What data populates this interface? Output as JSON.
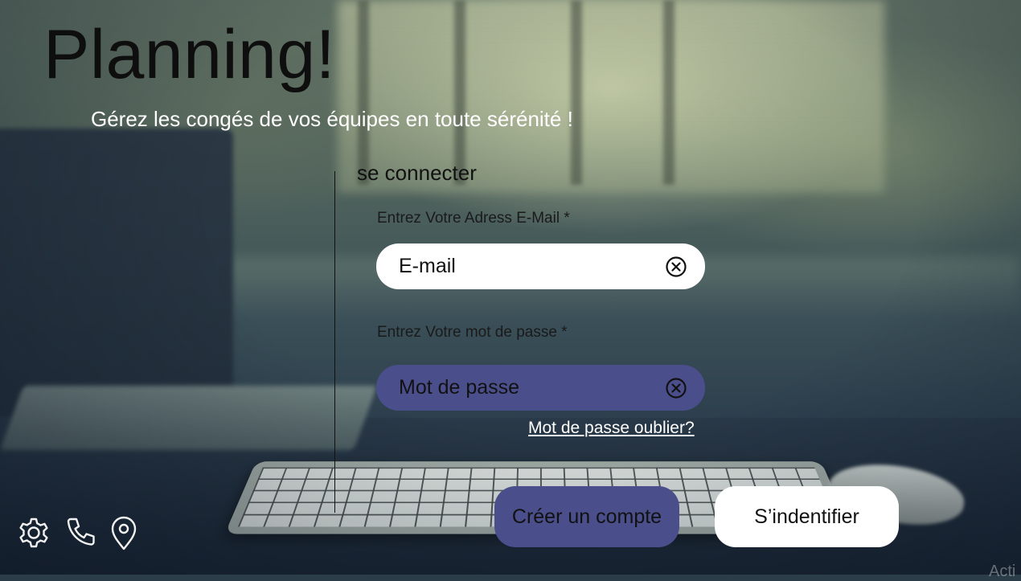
{
  "app": {
    "title": "Planning!",
    "tagline": "Gérez les congés de vos équipes en toute sérénité !"
  },
  "login": {
    "heading": "se connecter",
    "email_label": "Entrez Votre Adress E-Mail *",
    "email_placeholder": "E-mail",
    "email_value": "",
    "password_label": "Entrez Votre mot de passe *",
    "password_placeholder": "Mot de passe",
    "password_value": "",
    "clear_icon": "circle-x-icon",
    "forgot_link": "Mot de passe oublier?",
    "create_account_button": "Créer un compte",
    "sign_in_button": "S’indentifier"
  },
  "footer": {
    "icons": [
      "gear-icon",
      "phone-icon",
      "location-pin-icon"
    ]
  },
  "watermark": "Acti",
  "colors": {
    "accent_purple": "#4a4f8c",
    "title_text": "#0e0e0e",
    "light_text": "#ffffff",
    "button_white": "#ffffff"
  }
}
